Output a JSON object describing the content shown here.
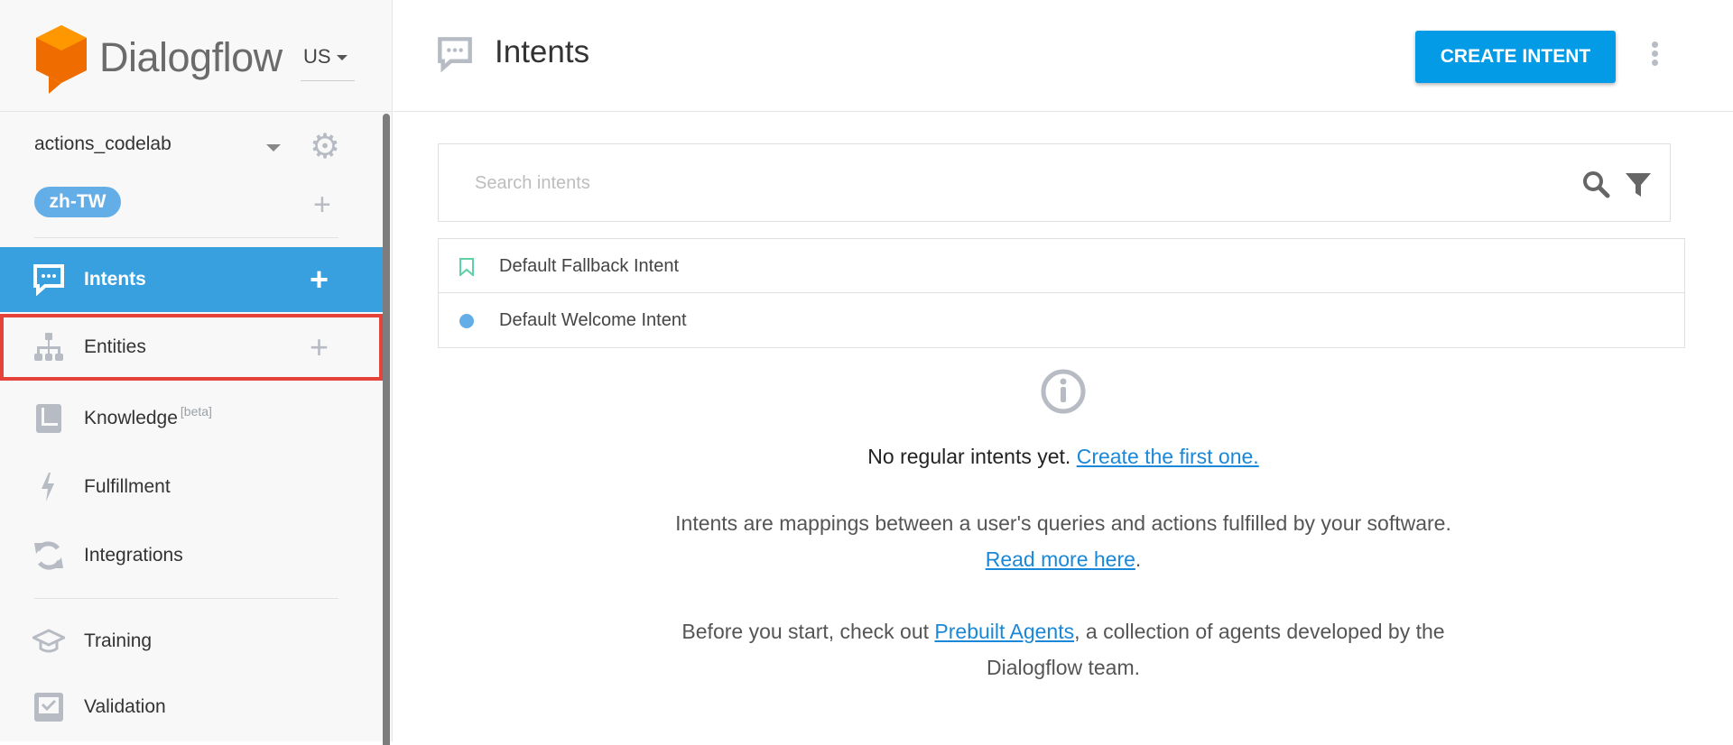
{
  "brand": {
    "name": "Dialogflow",
    "region": "US"
  },
  "agent": {
    "name": "actions_codelab",
    "language": "zh-TW"
  },
  "sidebar": {
    "items": [
      {
        "label": "Intents",
        "icon": "chat-icon",
        "active": true
      },
      {
        "label": "Entities",
        "icon": "hierarchy-icon",
        "highlighted": true
      },
      {
        "label": "Knowledge",
        "badge": "[beta]",
        "icon": "book-icon"
      },
      {
        "label": "Fulfillment",
        "icon": "bolt-icon"
      },
      {
        "label": "Integrations",
        "icon": "sync-icon"
      },
      {
        "label": "Training",
        "icon": "graduation-cap-icon"
      },
      {
        "label": "Validation",
        "icon": "checkbox-icon"
      }
    ]
  },
  "header": {
    "title": "Intents",
    "create_label": "CREATE INTENT"
  },
  "search": {
    "placeholder": "Search intents",
    "value": ""
  },
  "intents": [
    {
      "name": "Default Fallback Intent",
      "icon": "bookmark-icon"
    },
    {
      "name": "Default Welcome Intent",
      "icon": "dot-icon"
    }
  ],
  "empty": {
    "message": "No regular intents yet.",
    "message_link": "Create the first one.",
    "para1": "Intents are mappings between a user's queries and actions fulfilled by your software.",
    "para1_link": "Read more here",
    "para1_end": ".",
    "para2_start": "Before you start, check out",
    "para2_link": "Prebuilt Agents",
    "para2_end": ", a collection of agents developed by the Dialogflow team."
  },
  "colors": {
    "accent": "#039be5",
    "active_nav": "#39a0e0",
    "highlight": "#e5423a",
    "lang_pill": "#64aee8"
  }
}
